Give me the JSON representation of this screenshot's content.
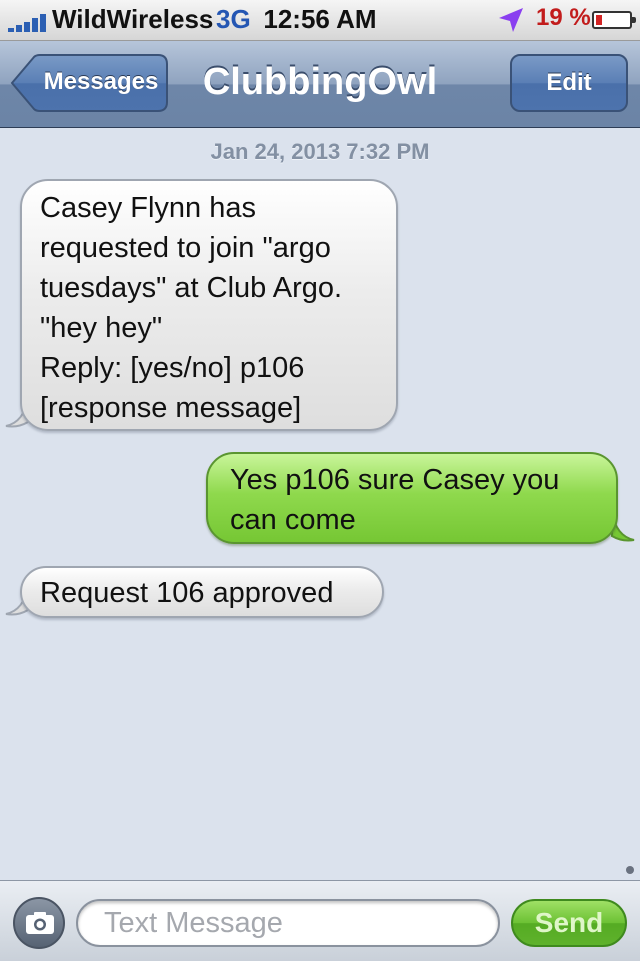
{
  "status_bar": {
    "carrier": "WildWireless",
    "network": "3G",
    "time": "12:56 AM",
    "battery_percent": "19 %",
    "battery_level": 0.19,
    "icons": [
      "signal-icon",
      "location-arrow-icon",
      "battery-icon"
    ]
  },
  "nav": {
    "back_label": "Messages",
    "title": "ClubbingOwl",
    "edit_label": "Edit"
  },
  "conversation": {
    "date": "Jan 24, 2013 7:32 PM",
    "messages": [
      {
        "direction": "received",
        "lines": [
          "Casey Flynn has",
          "requested to join \"argo",
          "tuesdays\" at Club Argo.",
          "\"hey hey\"",
          "Reply: [yes/no] p106",
          "[response message]"
        ]
      },
      {
        "direction": "sent",
        "lines": [
          "Yes p106 sure Casey you",
          "can come"
        ]
      },
      {
        "direction": "received",
        "lines": [
          "Request 106 approved"
        ]
      }
    ]
  },
  "input_bar": {
    "placeholder": "Text Message",
    "send_label": "Send",
    "camera_icon": "camera-icon"
  },
  "colors": {
    "background": "#dbe2ed",
    "sent_bubble": "#8fd94d",
    "received_bubble": "#ececec",
    "nav_bar": "#6e86a8",
    "battery_low": "#d32424"
  }
}
